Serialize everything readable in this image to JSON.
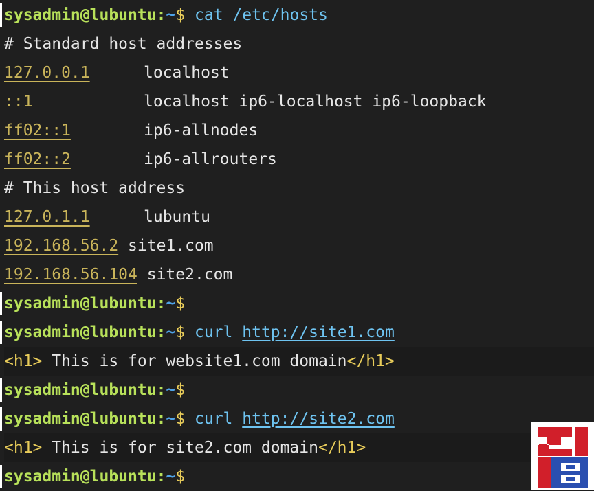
{
  "prompt": {
    "userhost": "sysadmin@lubuntu",
    "separator": ":",
    "path": "~",
    "symbol": "$"
  },
  "commands": {
    "cat": "cat /etc/hosts",
    "curl_label": "curl",
    "url1": "http://site1.com",
    "url2": "http://site2.com"
  },
  "hosts_file": {
    "comment1": "# Standard host addresses",
    "entries": [
      {
        "ip": "127.0.0.1",
        "names": "localhost"
      },
      {
        "ip": "::1",
        "names": "localhost ip6-localhost ip6-loopback"
      },
      {
        "ip": "ff02::1",
        "names": "ip6-allnodes"
      },
      {
        "ip": "ff02::2",
        "names": "ip6-allrouters"
      }
    ],
    "comment2": "# This host address",
    "entries2": [
      {
        "ip": "127.0.1.1",
        "names": "lubuntu"
      },
      {
        "ip": "192.168.56.2",
        "names": "site1.com"
      },
      {
        "ip": "192.168.56.104",
        "names": "site2.com"
      }
    ]
  },
  "responses": {
    "r1": {
      "open": "<h1>",
      "text": " This is for website1.com domain",
      "close": "</h1>"
    },
    "r2": {
      "open": "<h1>",
      "text": " This is for site2.com domain",
      "close": "</h1>"
    }
  },
  "colors": {
    "background": "#1f1f1f",
    "userhost": "#b8e15a",
    "path": "#4fa3e8",
    "command": "#6ec3f0",
    "ip": "#c9b45a"
  },
  "logo": {
    "icon": "site-logo-icon"
  }
}
